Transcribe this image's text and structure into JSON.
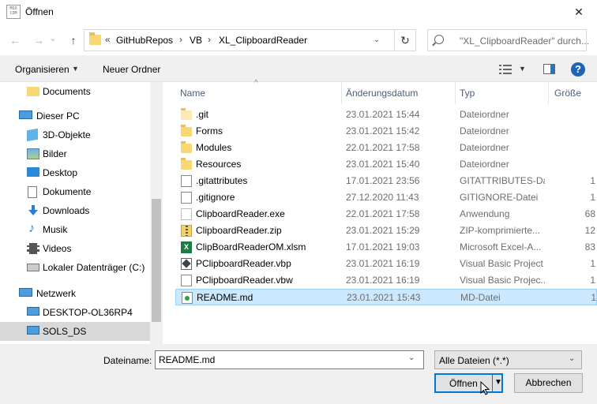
{
  "window": {
    "title": "Öffnen",
    "app_icon_text": "MSO\nCOM",
    "close_glyph": "✕"
  },
  "address": {
    "overflow": "«",
    "crumbs": [
      "GitHubRepos",
      "VB",
      "XL_ClipboardReader"
    ],
    "separator": "›",
    "search_placeholder": "\"XL_ClipboardReader\" durch..."
  },
  "nav_buttons": {
    "back": "←",
    "forward": "→",
    "history": "⌄",
    "up": "↑",
    "refresh": "↻"
  },
  "toolbar": {
    "organize_label": "Organisieren",
    "new_folder_label": "Neuer Ordner",
    "help_label": "?"
  },
  "nav": {
    "items": [
      {
        "label": "Documents",
        "icon": "folder-icon",
        "level": 1
      },
      {
        "label": "Dieser PC",
        "icon": "pc-icon",
        "level": 0
      },
      {
        "label": "3D-Objekte",
        "icon": "cube-icon",
        "level": 1
      },
      {
        "label": "Bilder",
        "icon": "pictures-icon",
        "level": 1
      },
      {
        "label": "Desktop",
        "icon": "desktop-icon",
        "level": 1
      },
      {
        "label": "Dokumente",
        "icon": "document-icon",
        "level": 1
      },
      {
        "label": "Downloads",
        "icon": "download-icon",
        "level": 1
      },
      {
        "label": "Musik",
        "icon": "music-icon",
        "level": 1
      },
      {
        "label": "Videos",
        "icon": "video-icon",
        "level": 1
      },
      {
        "label": "Lokaler Datenträger (C:)",
        "icon": "drive-icon",
        "level": 1
      },
      {
        "label": "Netzwerk",
        "icon": "network-icon",
        "level": 0
      },
      {
        "label": "DESKTOP-OL36RP4",
        "icon": "computer-icon",
        "level": 1
      },
      {
        "label": "SOLS_DS",
        "icon": "computer-icon",
        "level": 1,
        "selected": true
      }
    ]
  },
  "files": {
    "columns": {
      "name": "Name",
      "date": "Änderungsdatum",
      "type": "Typ",
      "size": "Größe"
    },
    "rows": [
      {
        "name": ".git",
        "date": "23.01.2021 15:44",
        "type": "Dateiordner",
        "size": "",
        "icon": "folder-icon",
        "hidden": true
      },
      {
        "name": "Forms",
        "date": "23.01.2021 15:42",
        "type": "Dateiordner",
        "size": "",
        "icon": "folder-icon"
      },
      {
        "name": "Modules",
        "date": "22.01.2021 17:58",
        "type": "Dateiordner",
        "size": "",
        "icon": "folder-icon"
      },
      {
        "name": "Resources",
        "date": "23.01.2021 15:40",
        "type": "Dateiordner",
        "size": "",
        "icon": "folder-icon"
      },
      {
        "name": ".gitattributes",
        "date": "17.01.2021 23:56",
        "type": "GITATTRIBUTES-Da...",
        "size": "1",
        "icon": "document-icon"
      },
      {
        "name": ".gitignore",
        "date": "27.12.2020 11:43",
        "type": "GITIGNORE-Datei",
        "size": "1",
        "icon": "document-icon"
      },
      {
        "name": "ClipboardReader.exe",
        "date": "22.01.2021 17:58",
        "type": "Anwendung",
        "size": "68",
        "icon": "exe-icon"
      },
      {
        "name": "ClipboardReader.zip",
        "date": "23.01.2021 15:29",
        "type": "ZIP-komprimierte...",
        "size": "12",
        "icon": "zip-icon"
      },
      {
        "name": "ClipBoardReaderOM.xlsm",
        "date": "17.01.2021 19:03",
        "type": "Microsoft Excel-A...",
        "size": "83",
        "icon": "excel-icon"
      },
      {
        "name": "PClipboardReader.vbp",
        "date": "23.01.2021 16:19",
        "type": "Visual Basic Project",
        "size": "1",
        "icon": "vbp-icon"
      },
      {
        "name": "PClipboardReader.vbw",
        "date": "23.01.2021 16:19",
        "type": "Visual Basic Projec...",
        "size": "1",
        "icon": "document-icon"
      },
      {
        "name": "README.md",
        "date": "23.01.2021 15:43",
        "type": "MD-Datei",
        "size": "1",
        "icon": "markdown-icon",
        "selected": true
      }
    ]
  },
  "bottom": {
    "filename_label": "Dateiname:",
    "filename_value": "README.md",
    "filter_value": "Alle Dateien (*.*)",
    "open_label": "Öffnen",
    "cancel_label": "Abbrechen"
  },
  "colors": {
    "accent": "#0078d7",
    "selection": "#cce8ff",
    "folder": "#f8d775"
  }
}
